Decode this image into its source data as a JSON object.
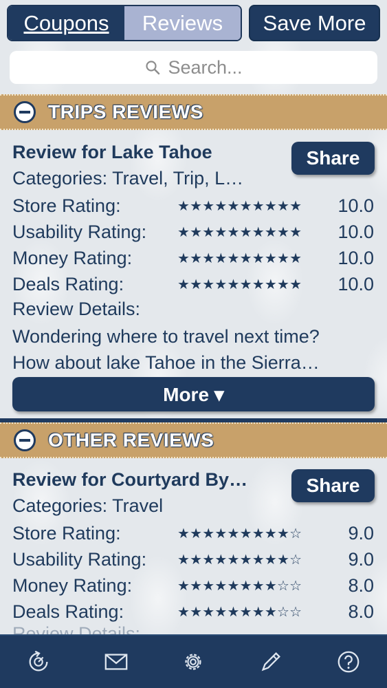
{
  "topbar": {
    "segments": [
      {
        "label": "Coupons"
      },
      {
        "label": "Reviews"
      }
    ],
    "save_more_label": "Save More"
  },
  "search": {
    "placeholder": "Search..."
  },
  "sections": [
    {
      "title": "TRIPS REVIEWS",
      "review": {
        "title": "Review for Lake Tahoe",
        "categories": "Categories: Travel, Trip, L…",
        "share_label": "Share",
        "ratings": [
          {
            "label": "Store Rating:",
            "stars": "★★★★★★★★★★",
            "value": "10.0"
          },
          {
            "label": "Usability Rating:",
            "stars": "★★★★★★★★★★",
            "value": "10.0"
          },
          {
            "label": "Money Rating:",
            "stars": "★★★★★★★★★★",
            "value": "10.0"
          },
          {
            "label": "Deals Rating:",
            "stars": "★★★★★★★★★★",
            "value": "10.0"
          }
        ],
        "details_label": "Review Details:",
        "details_line1": "Wondering where to travel next time?",
        "details_line2": "How about lake Tahoe in the Sierra…",
        "more_label": "More ▾"
      }
    },
    {
      "title": "OTHER REVIEWS",
      "review": {
        "title": "Review for Courtyard By…",
        "categories": "Categories: Travel",
        "share_label": "Share",
        "ratings": [
          {
            "label": "Store Rating:",
            "stars": "★★★★★★★★★☆",
            "value": "9.0"
          },
          {
            "label": "Usability Rating:",
            "stars": "★★★★★★★★★☆",
            "value": "9.0"
          },
          {
            "label": "Money Rating:",
            "stars": "★★★★★★★★☆☆",
            "value": "8.0"
          },
          {
            "label": "Deals Rating:",
            "stars": "★★★★★★★★☆☆",
            "value": "8.0"
          }
        ],
        "details_label": "Review Details:"
      }
    }
  ],
  "tabbar": {
    "icons": [
      "refresh-icon",
      "mail-icon",
      "gear-icon",
      "pencil-icon",
      "help-icon"
    ]
  },
  "colors": {
    "navy": "#1f3a5f",
    "tan": "#c8a16a",
    "segment_selected": "#a9b3d2"
  }
}
